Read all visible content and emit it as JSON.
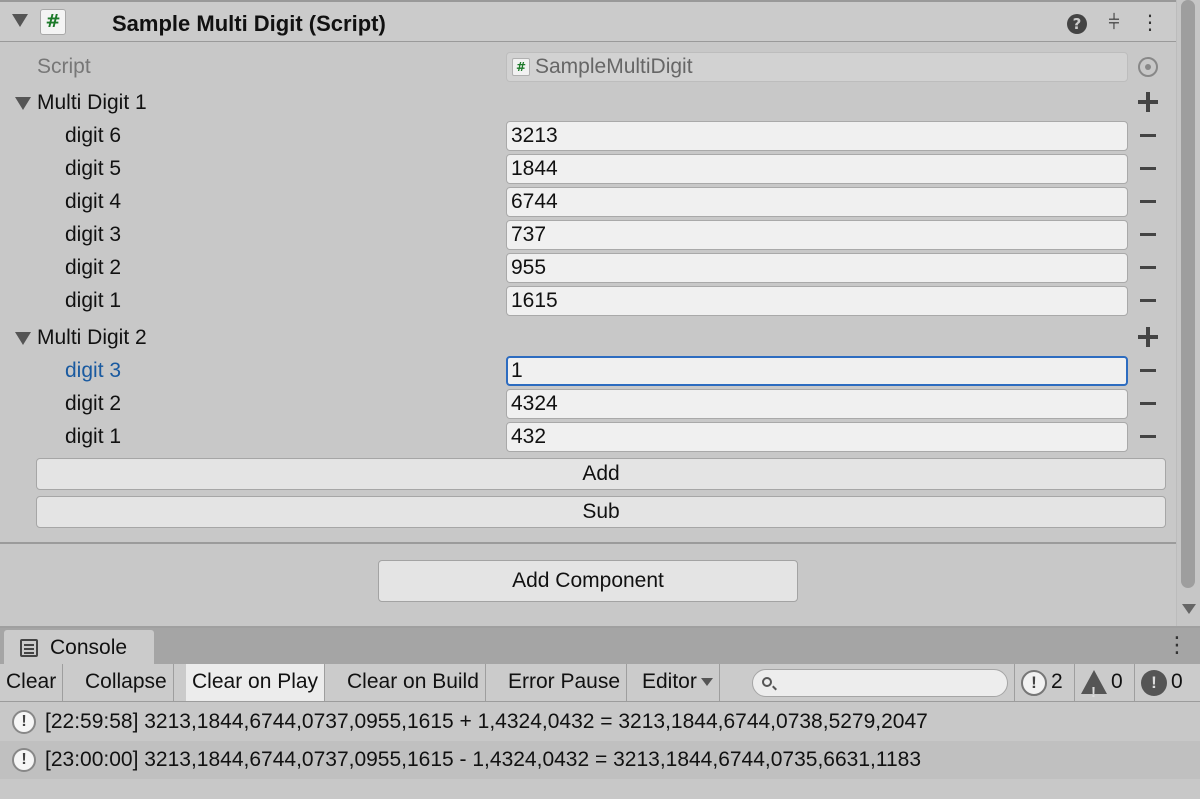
{
  "component": {
    "title": "Sample Multi Digit (Script)",
    "script_icon": "#",
    "icons": {
      "fold": "triangle-down-icon",
      "help": "help-icon",
      "presets": "sliders-icon",
      "menu": "kebab-icon"
    },
    "script_field": {
      "label": "Script",
      "value": "SampleMultiDigit",
      "icon": "#"
    }
  },
  "multi1": {
    "label": "Multi Digit 1",
    "items": [
      {
        "label": "digit 6",
        "value": "3213"
      },
      {
        "label": "digit 5",
        "value": "1844"
      },
      {
        "label": "digit 4",
        "value": "6744"
      },
      {
        "label": "digit 3",
        "value": "737"
      },
      {
        "label": "digit 2",
        "value": "955"
      },
      {
        "label": "digit 1",
        "value": "1615"
      }
    ]
  },
  "multi2": {
    "label": "Multi Digit 2",
    "items": [
      {
        "label": "digit 3",
        "value": "1",
        "focused": true
      },
      {
        "label": "digit 2",
        "value": "4324"
      },
      {
        "label": "digit 1",
        "value": "432"
      }
    ]
  },
  "buttons": {
    "add": "Add",
    "sub": "Sub",
    "add_component": "Add Component"
  },
  "console": {
    "tab_label": "Console",
    "toolbar": {
      "clear": "Clear",
      "collapse": "Collapse",
      "clear_on_play": "Clear on Play",
      "clear_on_build": "Clear on Build",
      "error_pause": "Error Pause",
      "editor": "Editor",
      "search_placeholder": ""
    },
    "counts": {
      "info": "2",
      "warn": "0",
      "error": "0"
    },
    "logs": [
      {
        "text": "[22:59:58] 3213,1844,6744,0737,0955,1615 + 1,4324,0432 = 3213,1844,6744,0738,5279,2047"
      },
      {
        "text": "[23:00:00] 3213,1844,6744,0737,0955,1615 - 1,4324,0432 = 3213,1844,6744,0735,6631,1183"
      }
    ]
  }
}
